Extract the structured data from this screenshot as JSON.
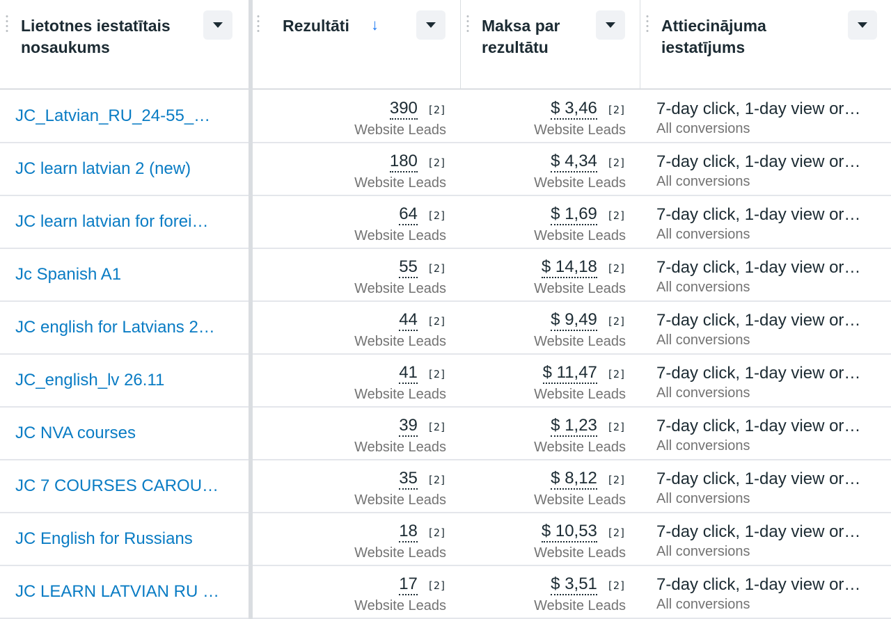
{
  "columns": {
    "name": "Lietotnes iestatītais nosaukums",
    "results": "Rezultāti",
    "cost": "Maksa par rezultātu",
    "attribution": "Attiecinājuma iestatījums"
  },
  "sort_indicator": "↓",
  "rows": [
    {
      "name": "JC_Latvian_RU_24-55_…",
      "results": "390",
      "results_note": "[2]",
      "results_type": "Website Leads",
      "cost": "$ 3,46",
      "cost_note": "[2]",
      "cost_type": "Website Leads",
      "attribution": "7-day click, 1-day view or…",
      "attribution_sub": "All conversions"
    },
    {
      "name": "JC learn latvian 2 (new)",
      "results": "180",
      "results_note": "[2]",
      "results_type": "Website Leads",
      "cost": "$ 4,34",
      "cost_note": "[2]",
      "cost_type": "Website Leads",
      "attribution": "7-day click, 1-day view or…",
      "attribution_sub": "All conversions"
    },
    {
      "name": "JC learn latvian for forei…",
      "results": "64",
      "results_note": "[2]",
      "results_type": "Website Leads",
      "cost": "$ 1,69",
      "cost_note": "[2]",
      "cost_type": "Website Leads",
      "attribution": "7-day click, 1-day view or…",
      "attribution_sub": "All conversions"
    },
    {
      "name": "Jc Spanish A1",
      "results": "55",
      "results_note": "[2]",
      "results_type": "Website Leads",
      "cost": "$ 14,18",
      "cost_note": "[2]",
      "cost_type": "Website Leads",
      "attribution": "7-day click, 1-day view or…",
      "attribution_sub": "All conversions"
    },
    {
      "name": "JC english for Latvians 2…",
      "results": "44",
      "results_note": "[2]",
      "results_type": "Website Leads",
      "cost": "$ 9,49",
      "cost_note": "[2]",
      "cost_type": "Website Leads",
      "attribution": "7-day click, 1-day view or…",
      "attribution_sub": "All conversions"
    },
    {
      "name": "JC_english_lv 26.11",
      "results": "41",
      "results_note": "[2]",
      "results_type": "Website Leads",
      "cost": "$ 11,47",
      "cost_note": "[2]",
      "cost_type": "Website Leads",
      "attribution": "7-day click, 1-day view or…",
      "attribution_sub": "All conversions"
    },
    {
      "name": "JC NVA courses",
      "results": "39",
      "results_note": "[2]",
      "results_type": "Website Leads",
      "cost": "$ 1,23",
      "cost_note": "[2]",
      "cost_type": "Website Leads",
      "attribution": "7-day click, 1-day view or…",
      "attribution_sub": "All conversions"
    },
    {
      "name": "JC 7 COURSES CAROU…",
      "results": "35",
      "results_note": "[2]",
      "results_type": "Website Leads",
      "cost": "$ 8,12",
      "cost_note": "[2]",
      "cost_type": "Website Leads",
      "attribution": "7-day click, 1-day view or…",
      "attribution_sub": "All conversions"
    },
    {
      "name": "JC English for Russians",
      "results": "18",
      "results_note": "[2]",
      "results_type": "Website Leads",
      "cost": "$ 10,53",
      "cost_note": "[2]",
      "cost_type": "Website Leads",
      "attribution": "7-day click, 1-day view or…",
      "attribution_sub": "All conversions"
    },
    {
      "name": "JC LEARN LATVIAN RU …",
      "results": "17",
      "results_note": "[2]",
      "results_type": "Website Leads",
      "cost": "$ 3,51",
      "cost_note": "[2]",
      "cost_type": "Website Leads",
      "attribution": "7-day click, 1-day view or…",
      "attribution_sub": "All conversions"
    }
  ]
}
